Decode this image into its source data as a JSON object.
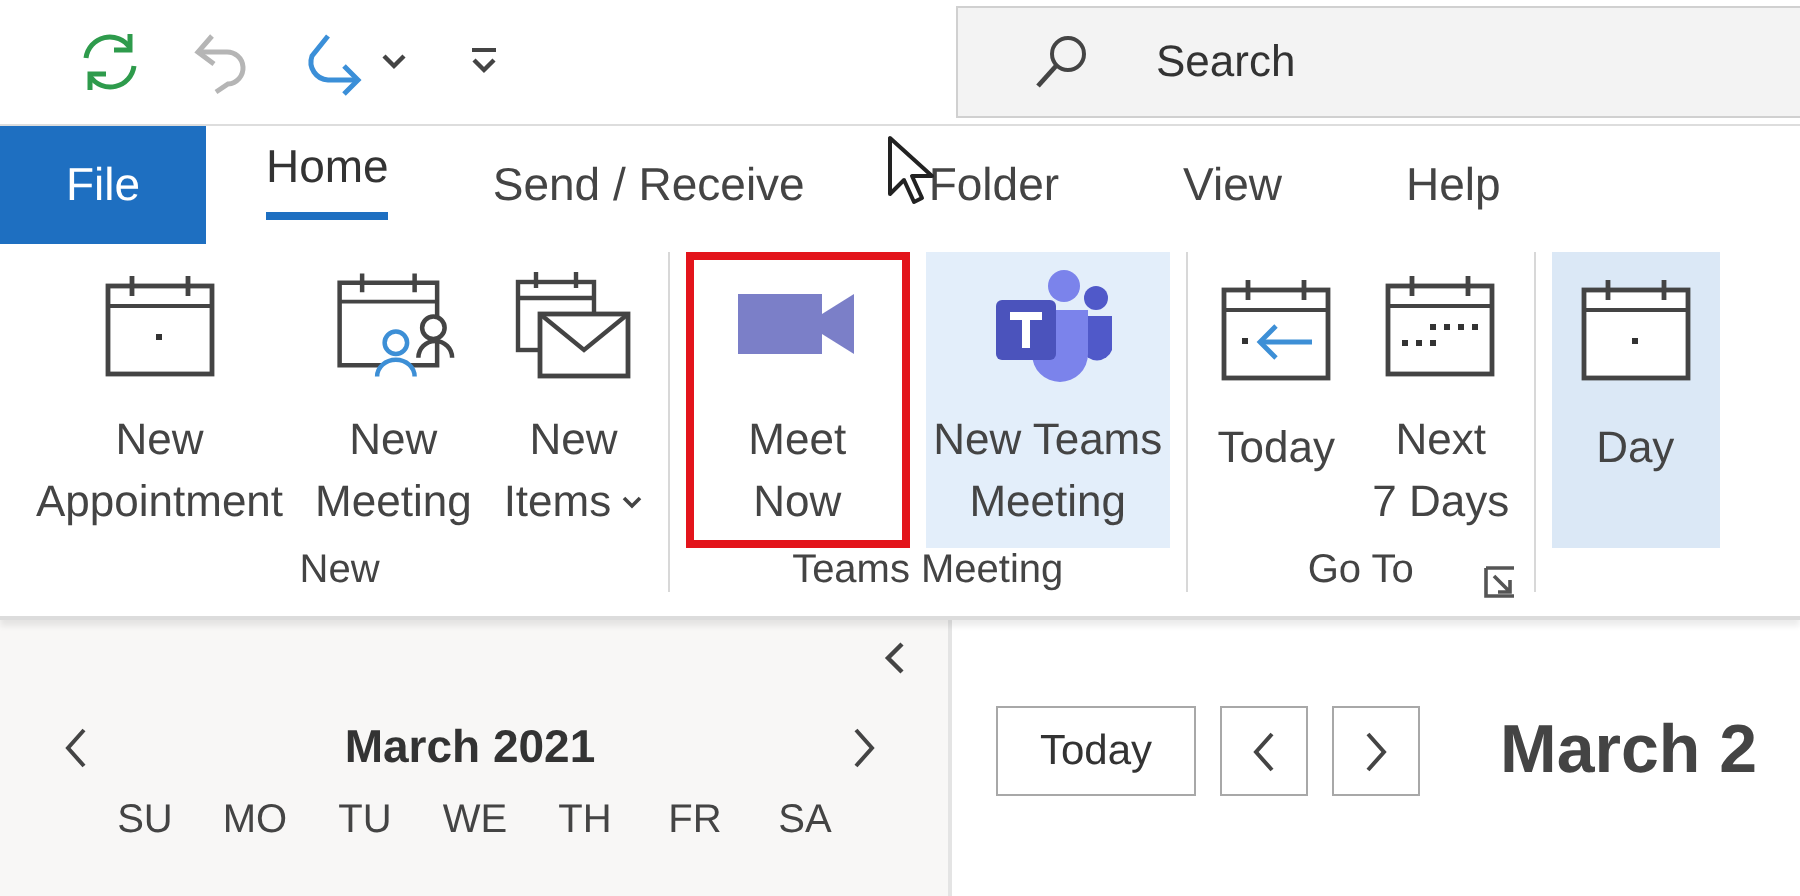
{
  "quick_access": [
    {
      "kind": "sync",
      "disabled": false
    },
    {
      "kind": "undo",
      "disabled": true
    },
    {
      "kind": "redo",
      "disabled": false
    },
    {
      "kind": "more",
      "disabled": false
    },
    {
      "kind": "customize",
      "disabled": false
    }
  ],
  "search": {
    "placeholder": "Search"
  },
  "tabs": [
    {
      "label": "File",
      "kind": "backstage",
      "selected": false
    },
    {
      "label": "Home",
      "kind": "tab",
      "selected": true
    },
    {
      "label": "Send / Receive",
      "kind": "tab",
      "selected": false
    },
    {
      "label": "Folder",
      "kind": "tab",
      "selected": false
    },
    {
      "label": "View",
      "kind": "tab",
      "selected": false
    },
    {
      "label": "Help",
      "kind": "tab",
      "selected": false
    }
  ],
  "ribbon": {
    "groups": [
      {
        "label": "New",
        "buttons": [
          {
            "lines": [
              "New",
              "Appointment"
            ],
            "selected": false,
            "hovered": false,
            "highlighted": false
          },
          {
            "lines": [
              "New",
              "Meeting"
            ],
            "selected": false,
            "hovered": false,
            "highlighted": false
          },
          {
            "lines": [
              "New",
              "Items"
            ],
            "dropdown": true,
            "selected": false,
            "hovered": false,
            "highlighted": false
          }
        ]
      },
      {
        "label": "Teams Meeting",
        "buttons": [
          {
            "lines": [
              "Meet",
              "Now"
            ],
            "selected": false,
            "hovered": false,
            "highlighted": true
          },
          {
            "lines": [
              "New Teams",
              "Meeting"
            ],
            "selected": false,
            "hovered": true,
            "highlighted": false
          }
        ]
      },
      {
        "label": "Go To",
        "launcher": true,
        "buttons": [
          {
            "lines": [
              "Today"
            ],
            "selected": false,
            "hovered": false,
            "highlighted": false
          },
          {
            "lines": [
              "Next",
              "7 Days"
            ],
            "selected": false,
            "hovered": false,
            "highlighted": false
          }
        ]
      },
      {
        "buttons": [
          {
            "lines": [
              "Day"
            ],
            "selected": true,
            "hovered": false,
            "highlighted": false
          }
        ]
      }
    ]
  },
  "navigation_pane": {
    "month": "March 2021",
    "weekdays": [
      "SU",
      "MO",
      "TU",
      "WE",
      "TH",
      "FR",
      "SA"
    ]
  },
  "calendar_view": {
    "today_button": "Today",
    "date_title": "March 2"
  }
}
